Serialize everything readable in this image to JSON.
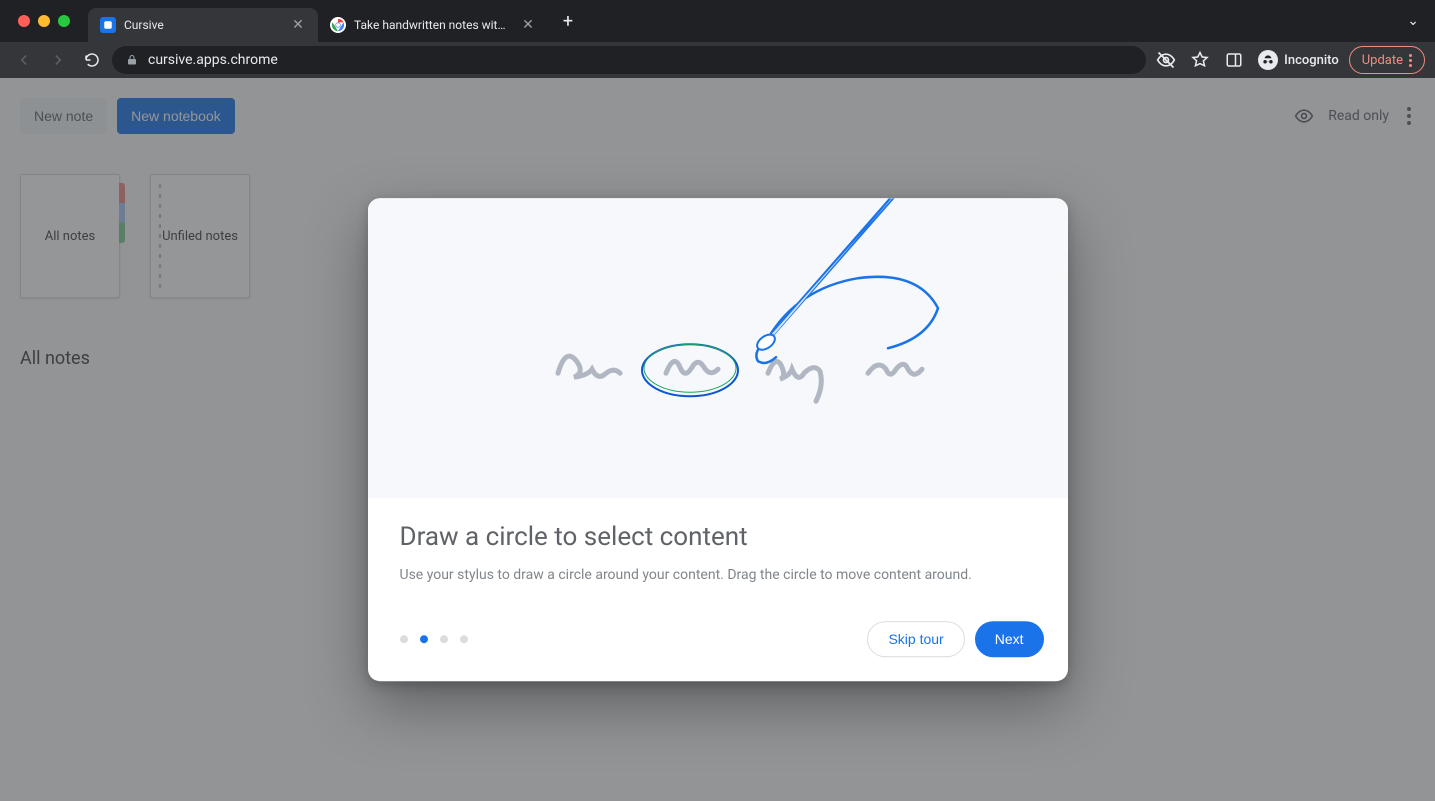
{
  "browser": {
    "tabs": [
      {
        "title": "Cursive",
        "active": true,
        "favicon_bg": "#1a73e8"
      },
      {
        "title": "Take handwritten notes with Cu",
        "active": false,
        "favicon_bg": "#ffffff"
      }
    ],
    "url": "cursive.apps.chrome",
    "incognito_label": "Incognito",
    "update_label": "Update"
  },
  "app": {
    "new_note_label": "New note",
    "new_notebook_label": "New notebook",
    "read_only_label": "Read only",
    "cards": {
      "all_notes": "All notes",
      "unfiled": "Unfiled notes"
    },
    "section_title": "All notes"
  },
  "tour": {
    "heading": "Draw a circle to select content",
    "body": "Use your stylus to draw a circle around your content. Drag the circle to move content around.",
    "skip_label": "Skip tour",
    "next_label": "Next",
    "step_index": 1,
    "step_count": 4
  }
}
